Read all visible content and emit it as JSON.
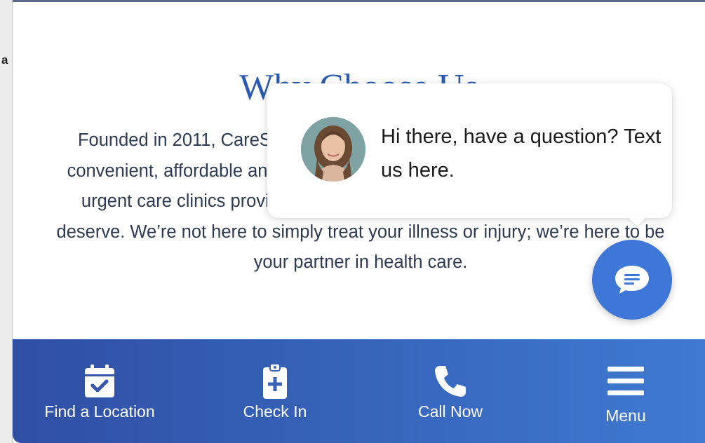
{
  "side_fragment": "a",
  "section": {
    "title": "Why Choose Us",
    "body": "Founded in 2011, CareSpot is dedicated to making health care services convenient, affordable and comprehensive. We go beyond what traditional urgent care clinics provide to offer the supportive care that our patients deserve. We’re not here to simply treat your illness or injury; we’re here to be your partner in health care."
  },
  "chat": {
    "message": "Hi there, have a question? Text us here.",
    "avatar_icon": "agent-photo",
    "launcher_icon": "chat-bubble-icon"
  },
  "bottom_nav": {
    "items": [
      {
        "label": "Find a Location",
        "icon": "calendar-check-icon"
      },
      {
        "label": "Check In",
        "icon": "clipboard-plus-icon"
      },
      {
        "label": "Call Now",
        "icon": "phone-icon"
      },
      {
        "label": "Menu",
        "icon": "hamburger-menu-icon"
      }
    ]
  },
  "colors": {
    "accent": "#3f77d8",
    "title": "#2a5bb0",
    "nav_gradient_start": "#2f4fa3",
    "nav_gradient_end": "#3f7ad0",
    "body_text": "#2d3a52"
  }
}
